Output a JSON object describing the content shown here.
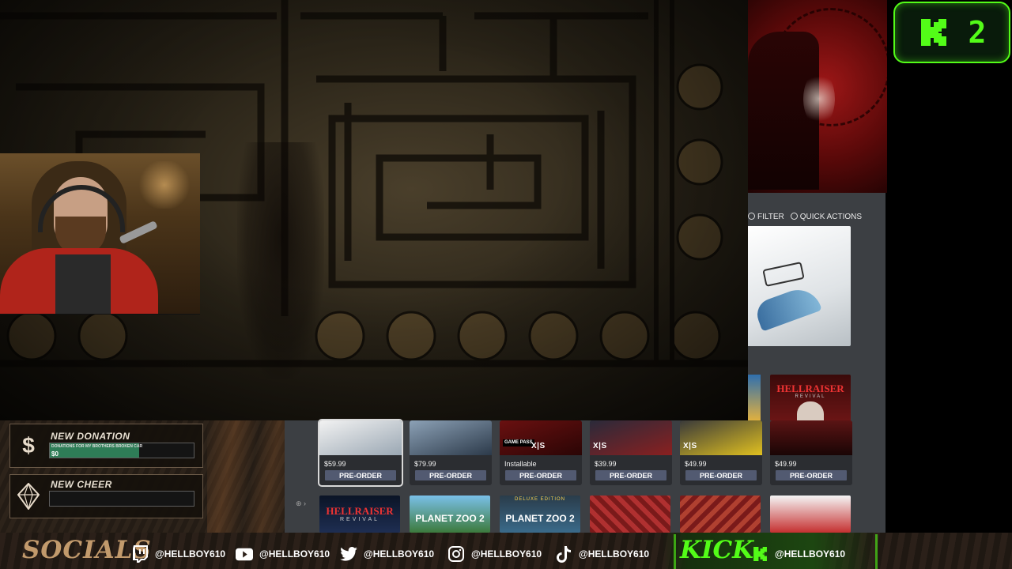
{
  "viewer_count": "2",
  "store": {
    "toolbar": {
      "filter": "FILTER",
      "quick_actions": "QUICK ACTIONS"
    },
    "games": [
      {
        "price": "$59.99",
        "action": "PRE-ORDER",
        "badge": ""
      },
      {
        "price": "$79.99",
        "action": "PRE-ORDER",
        "badge": ""
      },
      {
        "price": "Installable",
        "action": "PRE-ORDER",
        "badge": "X|S",
        "game_pass": "GAME PASS"
      },
      {
        "price": "$39.99",
        "action": "PRE-ORDER",
        "badge": "X|S"
      },
      {
        "price": "$49.99",
        "action": "PRE-ORDER",
        "badge": "X|S"
      },
      {
        "price": "$49.99",
        "action": "PRE-ORDER",
        "badge": ""
      }
    ],
    "covers": [
      {
        "title": "HELLRAISER",
        "subtitle": "REVIVAL"
      },
      {
        "title": "PLANET ZOO 2"
      },
      {
        "tag": "DELUXE EDITION",
        "title": "PLANET ZOO 2"
      }
    ],
    "hellraiser_title": "HELLRAISER",
    "hellraiser_sub": "REVIVAL"
  },
  "alerts": {
    "donation": {
      "title": "NEW DONATION",
      "goal_label": "DONATIONS FOR MY BROTHERS BROKEN CAR",
      "goal_amount": "$0",
      "goal_progress": 0.62
    },
    "cheer": {
      "title": "NEW CHEER"
    }
  },
  "socials": {
    "title": "SOCIALS",
    "twitch": "@HELLBOY610",
    "youtube": "@HELLBOY610",
    "twitter": "@HELLBOY610",
    "instagram": "@HELLBOY610",
    "tiktok": "@HELLBOY610",
    "kick_title": "KICK",
    "kick": "@HELLBOY610"
  },
  "colors": {
    "kick_green": "#53fc18",
    "store_bg": "#3c3f43",
    "preorder": "#525a71"
  }
}
